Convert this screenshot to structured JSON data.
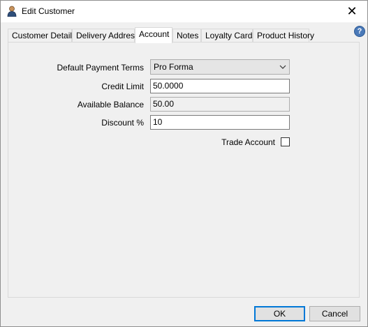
{
  "window": {
    "title": "Edit Customer",
    "close_glyph": "✕",
    "help_glyph": "?"
  },
  "tabs": [
    {
      "label": "Customer Details"
    },
    {
      "label": "Delivery Address"
    },
    {
      "label": "Account"
    },
    {
      "label": "Notes"
    },
    {
      "label": "Loyalty Cards"
    },
    {
      "label": "Product History"
    }
  ],
  "active_tab": "Account",
  "form": {
    "payment_terms_label": "Default Payment Terms",
    "payment_terms_value": "Pro Forma",
    "credit_limit_label": "Credit Limit",
    "credit_limit_value": "50.0000",
    "available_balance_label": "Available Balance",
    "available_balance_value": "50.00",
    "discount_label": "Discount %",
    "discount_value": "10",
    "trade_account_label": "Trade Account",
    "trade_account_checked": false
  },
  "buttons": {
    "ok": "OK",
    "cancel": "Cancel"
  },
  "colors": {
    "accent": "#0078d7",
    "help": "#4a79b8"
  }
}
